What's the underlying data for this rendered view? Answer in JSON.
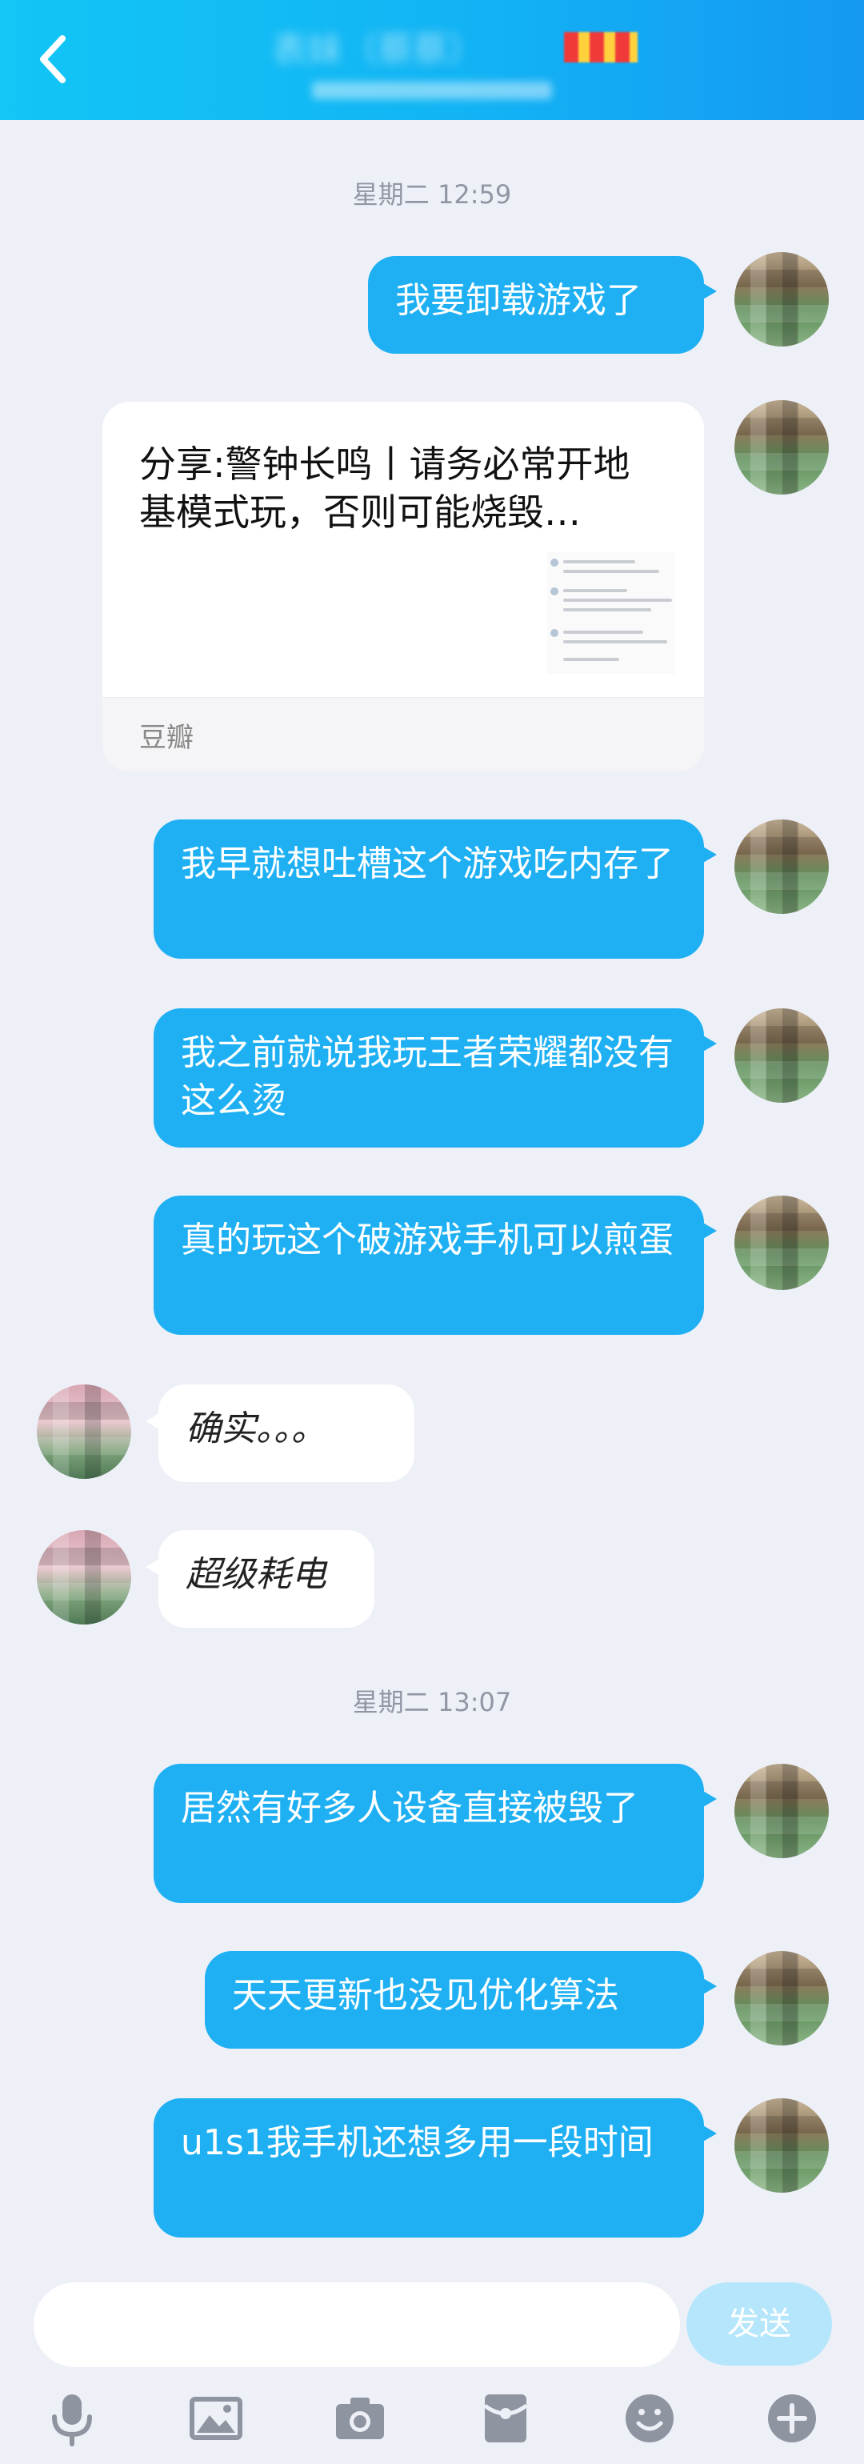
{
  "header": {
    "title": "表妹（蔡蔡）",
    "back_icon": "chevron-left-icon"
  },
  "timestamps": [
    "星期二 12:59",
    "星期二 13:07"
  ],
  "share_card": {
    "title": "分享:警钟长鸣丨请务必常开地基模式玩，否则可能烧毁…",
    "source": "豆瓣"
  },
  "messages": {
    "m1": "我要卸载游戏了",
    "m2": "我早就想吐槽这个游戏吃内存了",
    "m3": "我之前就说我玩王者荣耀都没有这么烫",
    "m4": "真的玩这个破游戏手机可以煎蛋",
    "m5": "确实。。。",
    "m6": "超级耗电",
    "m7": "居然有好多人设备直接被毁了",
    "m8": "天天更新也没见优化算法",
    "m9": "u1s1我手机还想多用一段时间"
  },
  "input": {
    "placeholder": "",
    "send_label": "发送"
  },
  "toolbar": {
    "icons": [
      "microphone-icon",
      "image-icon",
      "camera-icon",
      "red-packet-icon",
      "emoji-icon",
      "plus-icon"
    ]
  },
  "colors": {
    "header_start": "#12c6f6",
    "header_end": "#1599f2",
    "bubble_blue": "#1eb0f3",
    "background": "#eef0f8",
    "send_disabled": "#b6e6fb"
  }
}
